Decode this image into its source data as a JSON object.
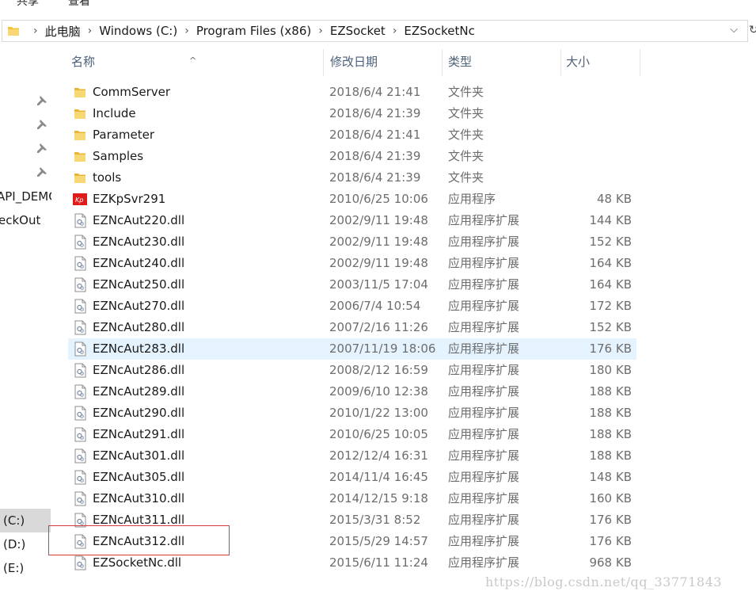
{
  "ribbon": {
    "tabs": [
      {
        "label": "共享"
      },
      {
        "label": "查看"
      }
    ]
  },
  "address_bar": {
    "crumbs": [
      "此电脑",
      "Windows (C:)",
      "Program Files (x86)",
      "EZSocket",
      "EZSocketNc"
    ],
    "dropdown_glyph": "⌵",
    "refresh_glyph": "↻"
  },
  "nav_pane": {
    "quick_access_items": [
      "API_DEMO",
      "eckOut"
    ],
    "drives": [
      {
        "label": "(C:)",
        "selected": true
      },
      {
        "label": "(D:)",
        "selected": false
      },
      {
        "label": "(E:)",
        "selected": false
      }
    ],
    "pin_icon": "pin-icon"
  },
  "columns": {
    "name": "名称",
    "date": "修改日期",
    "type": "类型",
    "size": "大小",
    "sort_glyph": "^"
  },
  "files": [
    {
      "name": "CommServer",
      "date": "2018/6/4 21:41",
      "type": "文件夹",
      "size": "",
      "icon": "folder-icon"
    },
    {
      "name": "Include",
      "date": "2018/6/4 21:39",
      "type": "文件夹",
      "size": "",
      "icon": "folder-icon"
    },
    {
      "name": "Parameter",
      "date": "2018/6/4 21:41",
      "type": "文件夹",
      "size": "",
      "icon": "folder-icon"
    },
    {
      "name": "Samples",
      "date": "2018/6/4 21:39",
      "type": "文件夹",
      "size": "",
      "icon": "folder-icon"
    },
    {
      "name": "tools",
      "date": "2018/6/4 21:39",
      "type": "文件夹",
      "size": "",
      "icon": "folder-icon"
    },
    {
      "name": "EZKpSvr291",
      "date": "2010/6/25 10:06",
      "type": "应用程序",
      "size": "48 KB",
      "icon": "exe-icon"
    },
    {
      "name": "EZNcAut220.dll",
      "date": "2002/9/11 19:48",
      "type": "应用程序扩展",
      "size": "144 KB",
      "icon": "dll-icon"
    },
    {
      "name": "EZNcAut230.dll",
      "date": "2002/9/11 19:48",
      "type": "应用程序扩展",
      "size": "152 KB",
      "icon": "dll-icon"
    },
    {
      "name": "EZNcAut240.dll",
      "date": "2002/9/11 19:48",
      "type": "应用程序扩展",
      "size": "164 KB",
      "icon": "dll-icon"
    },
    {
      "name": "EZNcAut250.dll",
      "date": "2003/11/5 17:04",
      "type": "应用程序扩展",
      "size": "164 KB",
      "icon": "dll-icon"
    },
    {
      "name": "EZNcAut270.dll",
      "date": "2006/7/4 10:54",
      "type": "应用程序扩展",
      "size": "172 KB",
      "icon": "dll-icon"
    },
    {
      "name": "EZNcAut280.dll",
      "date": "2007/2/16 11:26",
      "type": "应用程序扩展",
      "size": "152 KB",
      "icon": "dll-icon"
    },
    {
      "name": "EZNcAut283.dll",
      "date": "2007/11/19 18:06",
      "type": "应用程序扩展",
      "size": "176 KB",
      "icon": "dll-icon",
      "hover": true
    },
    {
      "name": "EZNcAut286.dll",
      "date": "2008/2/12 16:59",
      "type": "应用程序扩展",
      "size": "180 KB",
      "icon": "dll-icon"
    },
    {
      "name": "EZNcAut289.dll",
      "date": "2009/6/10 12:38",
      "type": "应用程序扩展",
      "size": "188 KB",
      "icon": "dll-icon"
    },
    {
      "name": "EZNcAut290.dll",
      "date": "2010/1/22 13:00",
      "type": "应用程序扩展",
      "size": "188 KB",
      "icon": "dll-icon"
    },
    {
      "name": "EZNcAut291.dll",
      "date": "2010/6/25 10:05",
      "type": "应用程序扩展",
      "size": "188 KB",
      "icon": "dll-icon"
    },
    {
      "name": "EZNcAut301.dll",
      "date": "2012/12/4 16:31",
      "type": "应用程序扩展",
      "size": "188 KB",
      "icon": "dll-icon"
    },
    {
      "name": "EZNcAut305.dll",
      "date": "2014/11/4 16:45",
      "type": "应用程序扩展",
      "size": "148 KB",
      "icon": "dll-icon"
    },
    {
      "name": "EZNcAut310.dll",
      "date": "2014/12/15 9:18",
      "type": "应用程序扩展",
      "size": "160 KB",
      "icon": "dll-icon"
    },
    {
      "name": "EZNcAut311.dll",
      "date": "2015/3/31 8:52",
      "type": "应用程序扩展",
      "size": "176 KB",
      "icon": "dll-icon"
    },
    {
      "name": "EZNcAut312.dll",
      "date": "2015/5/29 14:57",
      "type": "应用程序扩展",
      "size": "176 KB",
      "icon": "dll-icon",
      "boxed": true
    },
    {
      "name": "EZSocketNc.dll",
      "date": "2015/6/11 11:24",
      "type": "应用程序扩展",
      "size": "968 KB",
      "icon": "dll-icon"
    }
  ],
  "colors": {
    "hover_row": "#e5f3ff",
    "highlight_box": "#d93a3a",
    "folder": "#f3c33e",
    "exe_icon": "#e01b1b",
    "header_text": "#4c607a"
  },
  "watermark": "https://blog.csdn.net/qq_33771843"
}
